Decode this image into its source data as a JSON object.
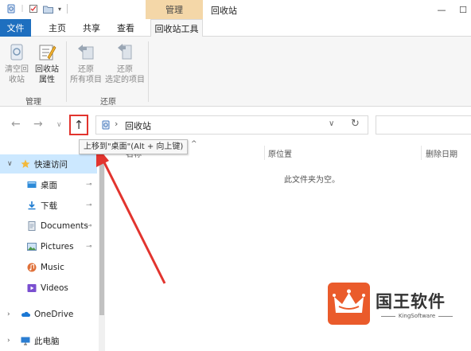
{
  "window": {
    "title": "回收站",
    "context_tab": "管理",
    "controls": {
      "minimize": "—",
      "maximize": "☐"
    }
  },
  "ribbon_tabs": [
    {
      "label": "文件"
    },
    {
      "label": "主页"
    },
    {
      "label": "共享"
    },
    {
      "label": "查看"
    },
    {
      "label": "回收站工具"
    }
  ],
  "ribbon": {
    "groups": [
      {
        "label": "管理",
        "buttons": [
          {
            "line1": "清空回",
            "line2": "收站",
            "icon": "empty-recycle-bin-icon"
          },
          {
            "line1": "回收站",
            "line2": "属性",
            "icon": "recycle-bin-properties-icon"
          }
        ]
      },
      {
        "label": "还原",
        "buttons": [
          {
            "line1": "还原",
            "line2": "所有项目",
            "icon": "restore-all-icon"
          },
          {
            "line1": "还原",
            "line2": "选定的项目",
            "icon": "restore-selected-icon"
          }
        ]
      }
    ]
  },
  "address_bar": {
    "back": "←",
    "forward": "→",
    "recent": "∨",
    "up": "↑",
    "path": "回收站",
    "separator": "›",
    "dropdown": "∨",
    "refresh": "↻"
  },
  "tooltip": "上移到\"桌面\"(Alt + 向上键)",
  "nav_pane": {
    "items": [
      {
        "label": "快速访问",
        "icon": "star-icon",
        "pinned": false
      },
      {
        "label": "桌面",
        "icon": "desktop-icon",
        "pinned": true
      },
      {
        "label": "下载",
        "icon": "download-icon",
        "pinned": true
      },
      {
        "label": "Documents",
        "icon": "documents-icon",
        "pinned": true
      },
      {
        "label": "Pictures",
        "icon": "pictures-icon",
        "pinned": true
      },
      {
        "label": "Music",
        "icon": "music-icon",
        "pinned": false
      },
      {
        "label": "Videos",
        "icon": "videos-icon",
        "pinned": false
      },
      {
        "label": "OneDrive",
        "icon": "onedrive-icon",
        "pinned": false
      },
      {
        "label": "此电脑",
        "icon": "this-pc-icon",
        "pinned": false
      }
    ],
    "pin_glyph": "📌"
  },
  "content": {
    "columns": [
      "名称",
      "原位置",
      "删除日期"
    ],
    "sort_caret": "^",
    "empty_text": "此文件夹为空。"
  },
  "watermark": {
    "name": "国王软件",
    "sub": "KingSoftware"
  },
  "colors": {
    "file_tab": "#1e6fbf",
    "context_tab": "#f4d7a8",
    "selected_nav": "#cce8ff",
    "highlight_red": "#e2342e",
    "logo_bg": "#ea5b2b"
  }
}
